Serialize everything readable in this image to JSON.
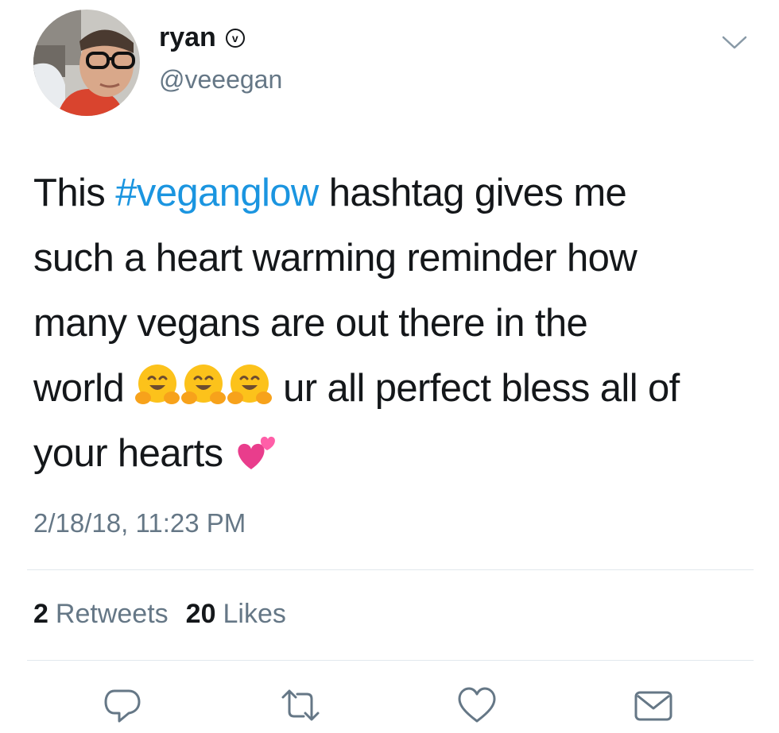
{
  "user": {
    "name": "ryan",
    "verified_glyph": "v",
    "handle": "@veeegan",
    "avatar_icon": "profile-photo"
  },
  "tweet": {
    "lines": [
      {
        "pre": "This ",
        "hashtag": "#veganglow",
        "post": " hashtag gives me"
      },
      {
        "text": "such a heart warming reminder how"
      },
      {
        "text": "many vegans are out there in the"
      },
      {
        "pre": "world",
        "emoji": [
          "hugging-face",
          "hugging-face",
          "hugging-face"
        ],
        "post": "ur all perfect bless all of"
      },
      {
        "text": "your hearts",
        "emoji": [
          "two-hearts"
        ]
      }
    ],
    "timestamp": "2/18/18, 11:23 PM"
  },
  "stats": {
    "retweets_count": "2",
    "retweets_label": "Retweets",
    "likes_count": "20",
    "likes_label": "Likes"
  },
  "actions": [
    "reply-icon",
    "retweet-icon",
    "like-icon",
    "share-icon"
  ],
  "colors": {
    "text": "#14171a",
    "secondary": "#657786",
    "link": "#1b95e0",
    "divider": "#e1e8ed"
  }
}
